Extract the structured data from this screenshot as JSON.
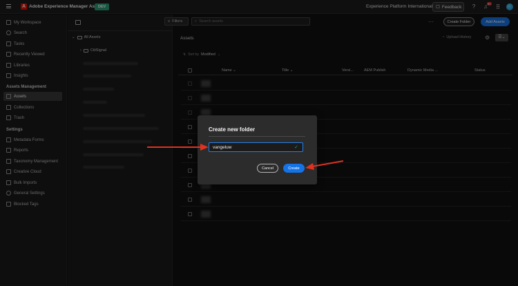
{
  "topbar": {
    "app_title": "Adobe Experience Manager Assets",
    "env_badge": "DEV",
    "org_name": "Experience Platform International",
    "feedback_label": "Feedback",
    "notification_count": "9+",
    "icons": [
      "menu-icon",
      "adobe-logo",
      "help-icon",
      "bell-icon",
      "apps-grid-icon",
      "avatar"
    ]
  },
  "sidebar": {
    "top_items": [
      {
        "label": "My Workspace",
        "icon": "home-icon"
      },
      {
        "label": "Search",
        "icon": "search-icon"
      },
      {
        "label": "Tasks",
        "icon": "tasks-icon"
      },
      {
        "label": "Recently Viewed",
        "icon": "clock-icon"
      },
      {
        "label": "Libraries",
        "icon": "library-icon"
      },
      {
        "label": "Insights",
        "icon": "chart-icon"
      }
    ],
    "assets_section": "Assets Management",
    "assets_items": [
      {
        "label": "Assets",
        "icon": "assets-icon",
        "active": true
      },
      {
        "label": "Collections",
        "icon": "collection-icon"
      },
      {
        "label": "Trash",
        "icon": "trash-icon"
      }
    ],
    "settings_section": "Settings",
    "settings_items": [
      {
        "label": "Metadata Forms",
        "icon": "form-icon"
      },
      {
        "label": "Reports",
        "icon": "report-icon"
      },
      {
        "label": "Taxonomy Management",
        "icon": "taxonomy-icon"
      },
      {
        "label": "Creative Cloud",
        "icon": "cloud-icon"
      },
      {
        "label": "Bulk Imports",
        "icon": "import-icon"
      },
      {
        "label": "General Settings",
        "icon": "settings-icon"
      },
      {
        "label": "Blocked Tags",
        "icon": "tag-icon"
      }
    ]
  },
  "tree": {
    "root": "All Assets",
    "first_folder": "CitiSignal"
  },
  "toolbar": {
    "filters_label": "Filters",
    "search_placeholder": "Search assets",
    "create_folder_label": "Create Folder",
    "add_assets_label": "Add Assets"
  },
  "main": {
    "title": "Assets",
    "upload_history": "Upload History",
    "sort_by_label": "Sort by",
    "sort_by_value": "Modified",
    "columns": [
      "Name",
      "Title",
      "Versi...",
      "AEM Publish",
      "Dynamic Media ...",
      "Status"
    ]
  },
  "dialog": {
    "title": "Create new folder",
    "input_value": "vangeluw",
    "cancel_label": "Cancel",
    "create_label": "Create"
  },
  "colors": {
    "accent_blue": "#1473e6",
    "annotation_red": "#e0321f",
    "env_badge_green": "#2d9d78"
  }
}
